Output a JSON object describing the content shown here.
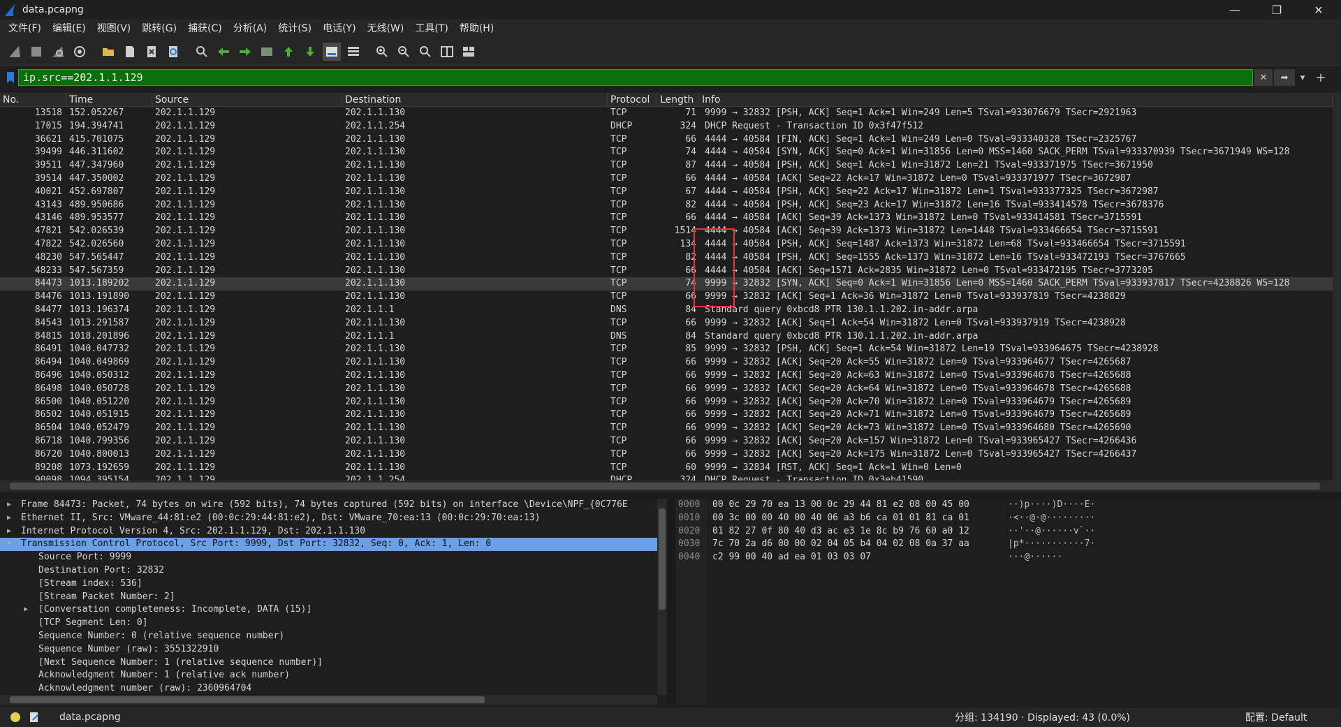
{
  "window": {
    "title": "data.pcapng",
    "controls": [
      "—",
      "❐",
      "✕"
    ]
  },
  "menu": [
    "文件(F)",
    "编辑(E)",
    "视图(V)",
    "跳转(G)",
    "捕获(C)",
    "分析(A)",
    "统计(S)",
    "电话(Y)",
    "无线(W)",
    "工具(T)",
    "帮助(H)"
  ],
  "toolbar_icons": [
    "shark-fin-start-icon",
    "stop-square-icon",
    "shark-fin-restart-icon",
    "gear-options-icon",
    "open-folder-icon",
    "file-icon",
    "close-file-icon",
    "reload-icon",
    "search-icon",
    "back-arrow-icon",
    "forward-arrow-icon",
    "go-to-packet-icon",
    "first-packet-icon",
    "last-packet-icon",
    "autoscroll-icon",
    "colorize-icon",
    "zoom-in-icon",
    "zoom-out-icon",
    "normal-size-icon",
    "resize-columns-icon",
    "layout-icon"
  ],
  "filter": {
    "value": "ip.src==202.1.1.129"
  },
  "columns": [
    "No.",
    "Time",
    "Source",
    "Destination",
    "Protocol",
    "Length",
    "Info"
  ],
  "packets": [
    {
      "no": "13518",
      "time": "152.052267",
      "src": "202.1.1.129",
      "dst": "202.1.1.130",
      "proto": "TCP",
      "len": "71",
      "info": "9999 → 32832 [PSH, ACK] Seq=1 Ack=1 Win=249 Len=5 TSval=933076679 TSecr=2921963"
    },
    {
      "no": "17015",
      "time": "194.394741",
      "src": "202.1.1.129",
      "dst": "202.1.1.254",
      "proto": "DHCP",
      "len": "324",
      "info": "DHCP Request  - Transaction ID 0x3f47f512"
    },
    {
      "no": "36621",
      "time": "415.701075",
      "src": "202.1.1.129",
      "dst": "202.1.1.130",
      "proto": "TCP",
      "len": "66",
      "info": "4444 → 40584 [FIN, ACK] Seq=1 Ack=1 Win=249 Len=0 TSval=933340328 TSecr=2325767"
    },
    {
      "no": "39499",
      "time": "446.311602",
      "src": "202.1.1.129",
      "dst": "202.1.1.130",
      "proto": "TCP",
      "len": "74",
      "info": "4444 → 40584 [SYN, ACK] Seq=0 Ack=1 Win=31856 Len=0 MSS=1460 SACK_PERM TSval=933370939 TSecr=3671949 WS=128"
    },
    {
      "no": "39511",
      "time": "447.347960",
      "src": "202.1.1.129",
      "dst": "202.1.1.130",
      "proto": "TCP",
      "len": "87",
      "info": "4444 → 40584 [PSH, ACK] Seq=1 Ack=1 Win=31872 Len=21 TSval=933371975 TSecr=3671950"
    },
    {
      "no": "39514",
      "time": "447.350002",
      "src": "202.1.1.129",
      "dst": "202.1.1.130",
      "proto": "TCP",
      "len": "66",
      "info": "4444 → 40584 [ACK] Seq=22 Ack=17 Win=31872 Len=0 TSval=933371977 TSecr=3672987"
    },
    {
      "no": "40021",
      "time": "452.697807",
      "src": "202.1.1.129",
      "dst": "202.1.1.130",
      "proto": "TCP",
      "len": "67",
      "info": "4444 → 40584 [PSH, ACK] Seq=22 Ack=17 Win=31872 Len=1 TSval=933377325 TSecr=3672987"
    },
    {
      "no": "43143",
      "time": "489.950686",
      "src": "202.1.1.129",
      "dst": "202.1.1.130",
      "proto": "TCP",
      "len": "82",
      "info": "4444 → 40584 [PSH, ACK] Seq=23 Ack=17 Win=31872 Len=16 TSval=933414578 TSecr=3678376"
    },
    {
      "no": "43146",
      "time": "489.953577",
      "src": "202.1.1.129",
      "dst": "202.1.1.130",
      "proto": "TCP",
      "len": "66",
      "info": "4444 → 40584 [ACK] Seq=39 Ack=1373 Win=31872 Len=0 TSval=933414581 TSecr=3715591"
    },
    {
      "no": "47821",
      "time": "542.026539",
      "src": "202.1.1.129",
      "dst": "202.1.1.130",
      "proto": "TCP",
      "len": "1514",
      "info": "4444 → 40584 [ACK] Seq=39 Ack=1373 Win=31872 Len=1448 TSval=933466654 TSecr=3715591"
    },
    {
      "no": "47822",
      "time": "542.026560",
      "src": "202.1.1.129",
      "dst": "202.1.1.130",
      "proto": "TCP",
      "len": "134",
      "info": "4444 → 40584 [PSH, ACK] Seq=1487 Ack=1373 Win=31872 Len=68 TSval=933466654 TSecr=3715591"
    },
    {
      "no": "48230",
      "time": "547.565447",
      "src": "202.1.1.129",
      "dst": "202.1.1.130",
      "proto": "TCP",
      "len": "82",
      "info": "4444 → 40584 [PSH, ACK] Seq=1555 Ack=1373 Win=31872 Len=16 TSval=933472193 TSecr=3767665"
    },
    {
      "no": "48233",
      "time": "547.567359",
      "src": "202.1.1.129",
      "dst": "202.1.1.130",
      "proto": "TCP",
      "len": "66",
      "info": "4444 → 40584 [ACK] Seq=1571 Ack=2835 Win=31872 Len=0 TSval=933472195 TSecr=3773205"
    },
    {
      "no": "84473",
      "time": "1013.189202",
      "src": "202.1.1.129",
      "dst": "202.1.1.130",
      "proto": "TCP",
      "len": "74",
      "info": "9999 → 32832 [SYN, ACK] Seq=0 Ack=1 Win=31856 Len=0 MSS=1460 SACK_PERM TSval=933937817 TSecr=4238826 WS=128",
      "selected": true
    },
    {
      "no": "84476",
      "time": "1013.191890",
      "src": "202.1.1.129",
      "dst": "202.1.1.130",
      "proto": "TCP",
      "len": "66",
      "info": "9999 → 32832 [ACK] Seq=1 Ack=36 Win=31872 Len=0 TSval=933937819 TSecr=4238829"
    },
    {
      "no": "84477",
      "time": "1013.196374",
      "src": "202.1.1.129",
      "dst": "202.1.1.1",
      "proto": "DNS",
      "len": "84",
      "info": "Standard query 0xbcd8 PTR 130.1.1.202.in-addr.arpa"
    },
    {
      "no": "84543",
      "time": "1013.291587",
      "src": "202.1.1.129",
      "dst": "202.1.1.130",
      "proto": "TCP",
      "len": "66",
      "info": "9999 → 32832 [ACK] Seq=1 Ack=54 Win=31872 Len=0 TSval=933937919 TSecr=4238928"
    },
    {
      "no": "84815",
      "time": "1018.201896",
      "src": "202.1.1.129",
      "dst": "202.1.1.1",
      "proto": "DNS",
      "len": "84",
      "info": "Standard query 0xbcd8 PTR 130.1.1.202.in-addr.arpa"
    },
    {
      "no": "86491",
      "time": "1040.047732",
      "src": "202.1.1.129",
      "dst": "202.1.1.130",
      "proto": "TCP",
      "len": "85",
      "info": "9999 → 32832 [PSH, ACK] Seq=1 Ack=54 Win=31872 Len=19 TSval=933964675 TSecr=4238928"
    },
    {
      "no": "86494",
      "time": "1040.049869",
      "src": "202.1.1.129",
      "dst": "202.1.1.130",
      "proto": "TCP",
      "len": "66",
      "info": "9999 → 32832 [ACK] Seq=20 Ack=55 Win=31872 Len=0 TSval=933964677 TSecr=4265687"
    },
    {
      "no": "86496",
      "time": "1040.050312",
      "src": "202.1.1.129",
      "dst": "202.1.1.130",
      "proto": "TCP",
      "len": "66",
      "info": "9999 → 32832 [ACK] Seq=20 Ack=63 Win=31872 Len=0 TSval=933964678 TSecr=4265688"
    },
    {
      "no": "86498",
      "time": "1040.050728",
      "src": "202.1.1.129",
      "dst": "202.1.1.130",
      "proto": "TCP",
      "len": "66",
      "info": "9999 → 32832 [ACK] Seq=20 Ack=64 Win=31872 Len=0 TSval=933964678 TSecr=4265688"
    },
    {
      "no": "86500",
      "time": "1040.051220",
      "src": "202.1.1.129",
      "dst": "202.1.1.130",
      "proto": "TCP",
      "len": "66",
      "info": "9999 → 32832 [ACK] Seq=20 Ack=70 Win=31872 Len=0 TSval=933964679 TSecr=4265689"
    },
    {
      "no": "86502",
      "time": "1040.051915",
      "src": "202.1.1.129",
      "dst": "202.1.1.130",
      "proto": "TCP",
      "len": "66",
      "info": "9999 → 32832 [ACK] Seq=20 Ack=71 Win=31872 Len=0 TSval=933964679 TSecr=4265689"
    },
    {
      "no": "86504",
      "time": "1040.052479",
      "src": "202.1.1.129",
      "dst": "202.1.1.130",
      "proto": "TCP",
      "len": "66",
      "info": "9999 → 32832 [ACK] Seq=20 Ack=73 Win=31872 Len=0 TSval=933964680 TSecr=4265690"
    },
    {
      "no": "86718",
      "time": "1040.799356",
      "src": "202.1.1.129",
      "dst": "202.1.1.130",
      "proto": "TCP",
      "len": "66",
      "info": "9999 → 32832 [ACK] Seq=20 Ack=157 Win=31872 Len=0 TSval=933965427 TSecr=4266436"
    },
    {
      "no": "86720",
      "time": "1040.800013",
      "src": "202.1.1.129",
      "dst": "202.1.1.130",
      "proto": "TCP",
      "len": "66",
      "info": "9999 → 32832 [ACK] Seq=20 Ack=175 Win=31872 Len=0 TSval=933965427 TSecr=4266437"
    },
    {
      "no": "89208",
      "time": "1073.192659",
      "src": "202.1.1.129",
      "dst": "202.1.1.130",
      "proto": "TCP",
      "len": "60",
      "info": "9999 → 32834 [RST, ACK] Seq=1 Ack=1 Win=0 Len=0"
    },
    {
      "no": "90098",
      "time": "1094.395154",
      "src": "202.1.1.129",
      "dst": "202.1.1.254",
      "proto": "DHCP",
      "len": "324",
      "info": "DHCP Request  - Transaction ID 0x3eb41590"
    }
  ],
  "details": [
    {
      "level": 0,
      "tw": "▶",
      "text": "Frame 84473: Packet, 74 bytes on wire (592 bits), 74 bytes captured (592 bits) on interface \\Device\\NPF_{0C776E"
    },
    {
      "level": 0,
      "tw": "▶",
      "text": "Ethernet II, Src: VMware_44:81:e2 (00:0c:29:44:81:e2), Dst: VMware_70:ea:13 (00:0c:29:70:ea:13)"
    },
    {
      "level": 0,
      "tw": "▶",
      "text": "Internet Protocol Version 4, Src: 202.1.1.129, Dst: 202.1.1.130"
    },
    {
      "level": 0,
      "tw": "▼",
      "text": "Transmission Control Protocol, Src Port: 9999, Dst Port: 32832, Seq: 0, Ack: 1, Len: 0",
      "selected": true
    },
    {
      "level": 1,
      "tw": "",
      "text": "Source Port: 9999"
    },
    {
      "level": 1,
      "tw": "",
      "text": "Destination Port: 32832"
    },
    {
      "level": 1,
      "tw": "",
      "text": "[Stream index: 536]"
    },
    {
      "level": 1,
      "tw": "",
      "text": "[Stream Packet Number: 2]"
    },
    {
      "level": 1,
      "tw": "▶",
      "text": "[Conversation completeness: Incomplete, DATA (15)]"
    },
    {
      "level": 1,
      "tw": "",
      "text": "[TCP Segment Len: 0]"
    },
    {
      "level": 1,
      "tw": "",
      "text": "Sequence Number: 0    (relative sequence number)"
    },
    {
      "level": 1,
      "tw": "",
      "text": "Sequence Number (raw): 3551322910"
    },
    {
      "level": 1,
      "tw": "",
      "text": "[Next Sequence Number: 1    (relative sequence number)]"
    },
    {
      "level": 1,
      "tw": "",
      "text": "Acknowledgment Number: 1    (relative ack number)"
    },
    {
      "level": 1,
      "tw": "",
      "text": "Acknowledgment number (raw): 2360964704"
    }
  ],
  "bytes": [
    {
      "off": "0000",
      "hex": "00 0c 29 70 ea 13 00 0c  29 44 81 e2 08 00 45 00",
      "ascii": "··)p····)D····E·"
    },
    {
      "off": "0010",
      "hex": "00 3c 00 00 40 00 40 06  a3 b6 ca 01 01 81 ca 01",
      "ascii": "·<··@·@·········"
    },
    {
      "off": "0020",
      "hex": "01 82 27 0f 80 40 d3 ac  e3 1e 8c b9 76 60 a0 12",
      "ascii": "··'··@······v`··"
    },
    {
      "off": "0030",
      "hex": "7c 70 2a d6 00 00 02 04  05 b4 04 02 08 0a 37 aa",
      "ascii": "|p*···········7·"
    },
    {
      "off": "0040",
      "hex": "c2 99 00 40 ad ea 01 03  03 07",
      "ascii": "···@······"
    }
  ],
  "status": {
    "file": "data.pcapng",
    "stats": "分组: 134190 · Displayed: 43 (0.0%)",
    "profile": "配置: Default"
  },
  "colors": {
    "filter_bg": "#0b6e0b",
    "selected_detail": "#6aa0e8",
    "annotation_box": "#e8353b"
  }
}
